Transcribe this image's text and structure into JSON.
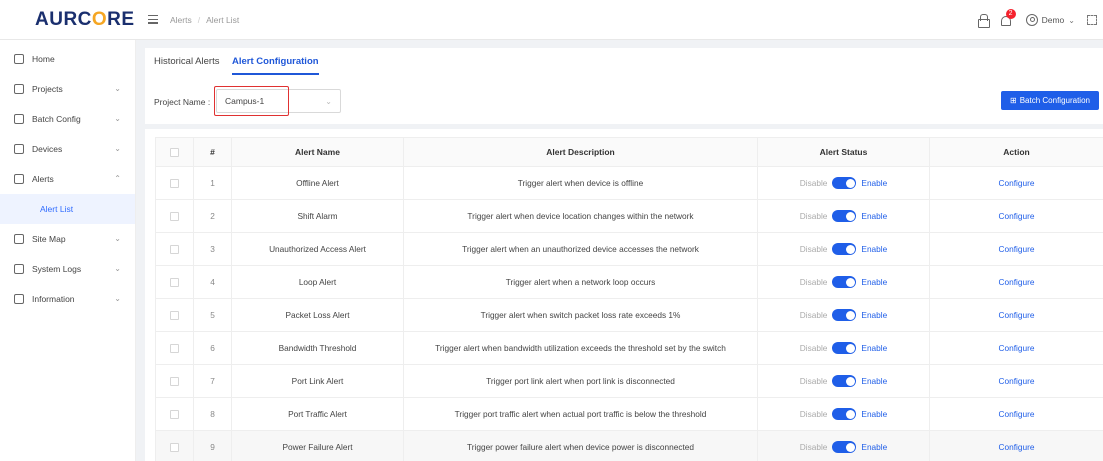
{
  "brand": {
    "prefix": "AURC",
    "accent_letter": "O",
    "suffix": "RE"
  },
  "breadcrumb": [
    "Alerts",
    "Alert List"
  ],
  "header": {
    "notification_count": "2",
    "user_name": "Demo"
  },
  "sidebar": {
    "items": [
      {
        "label": "Home",
        "has_arrow": false,
        "arrow": ""
      },
      {
        "label": "Projects",
        "arrow": "⌄"
      },
      {
        "label": "Batch Config",
        "arrow": "⌄"
      },
      {
        "label": "Devices",
        "arrow": "⌄"
      },
      {
        "label": "Alerts",
        "arrow": "⌃"
      },
      {
        "label": "Site Map",
        "arrow": "⌄"
      },
      {
        "label": "System Logs",
        "arrow": "⌄"
      },
      {
        "label": "Information",
        "arrow": "⌄"
      }
    ],
    "active_sub": "Alert List"
  },
  "tabs": [
    {
      "label": "Historical Alerts",
      "active": false
    },
    {
      "label": "Alert Configuration",
      "active": true
    }
  ],
  "filter": {
    "label": "Project Name :",
    "value": "Campus-1"
  },
  "batch_button": "Batch Configuration",
  "table": {
    "headers": [
      "#",
      "Alert Name",
      "Alert Description",
      "Alert Status",
      "Action"
    ],
    "status_off": "Disable",
    "status_on": "Enable",
    "action_label": "Configure",
    "rows": [
      {
        "idx": "1",
        "name": "Offline Alert",
        "desc": "Trigger alert when device is offline"
      },
      {
        "idx": "2",
        "name": "Shift Alarm",
        "desc": "Trigger alert when device location changes within the network"
      },
      {
        "idx": "3",
        "name": "Unauthorized Access Alert",
        "desc": "Trigger alert when an unauthorized device accesses the network"
      },
      {
        "idx": "4",
        "name": "Loop Alert",
        "desc": "Trigger alert when a network loop occurs"
      },
      {
        "idx": "5",
        "name": "Packet Loss Alert",
        "desc": "Trigger alert when switch packet loss rate exceeds 1%"
      },
      {
        "idx": "6",
        "name": "Bandwidth Threshold",
        "desc": "Trigger alert when bandwidth utilization exceeds the threshold set by the switch"
      },
      {
        "idx": "7",
        "name": "Port Link Alert",
        "desc": "Trigger port link alert when port link is disconnected"
      },
      {
        "idx": "8",
        "name": "Port Traffic Alert",
        "desc": "Trigger port traffic alert when actual port traffic is below the threshold"
      },
      {
        "idx": "9",
        "name": "Power Failure Alert",
        "desc": "Trigger power failure alert when device power is disconnected"
      }
    ]
  },
  "colors": {
    "accent": "#1f5ee8",
    "logo_text": "#1a2f6e",
    "logo_accent": "#f5a623",
    "highlight_border": "#e03131"
  }
}
